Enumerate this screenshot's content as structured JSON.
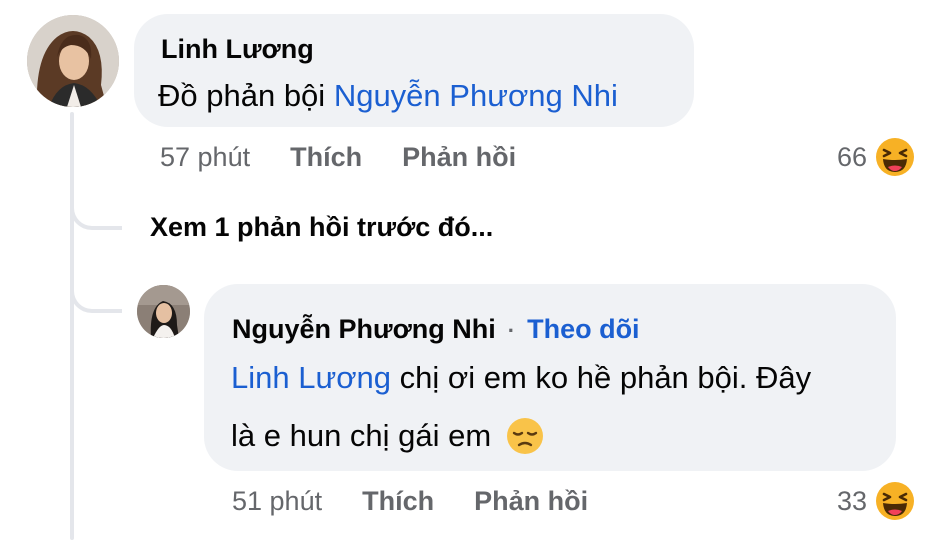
{
  "comment": {
    "author": "Linh Lương",
    "text_before": "Đồ phản bội ",
    "mention": "Nguyễn Phương Nhi",
    "time": "57 phút",
    "like_label": "Thích",
    "reply_label": "Phản hồi",
    "reaction_count": "66",
    "reaction_icon": "laughing-emoji-icon"
  },
  "view_previous": "Xem 1 phản hồi trước đó...",
  "reply": {
    "author": "Nguyễn Phương Nhi",
    "separator": "·",
    "follow_label": "Theo dõi",
    "mention": "Linh Lương",
    "text_line1": " chị ơi em ko hề phản bội. Đây",
    "text_line2": "là e hun chị gái em ",
    "inline_emoji": "sad-face-emoji-icon",
    "time": "51 phút",
    "like_label": "Thích",
    "reply_label": "Phản hồi",
    "reaction_count": "33",
    "reaction_icon": "laughing-emoji-icon"
  },
  "colors": {
    "bubble": "#f0f2f5",
    "link": "#1b5fd1",
    "meta": "#65676b",
    "thread_line": "#e4e6eb"
  }
}
